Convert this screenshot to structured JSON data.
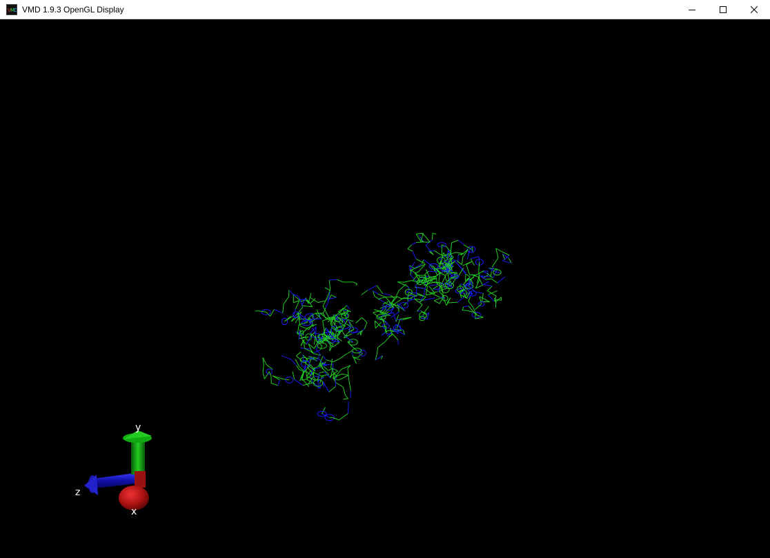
{
  "window": {
    "title": "VMD 1.9.3 OpenGL Display",
    "app_icon": "vmd-logo-icon",
    "controls": {
      "minimize": "minimize-icon",
      "maximize": "maximize-icon",
      "close": "close-icon"
    }
  },
  "display": {
    "background_color": "#000000",
    "molecule": {
      "representation": "lines",
      "colors": {
        "carbon": "#22cc22",
        "nitrogen": "#1a1aee"
      }
    },
    "axes": {
      "x": {
        "label": "x",
        "color": "#cc1111"
      },
      "y": {
        "label": "y",
        "color": "#11aa11"
      },
      "z": {
        "label": "z",
        "color": "#1111cc"
      }
    }
  }
}
